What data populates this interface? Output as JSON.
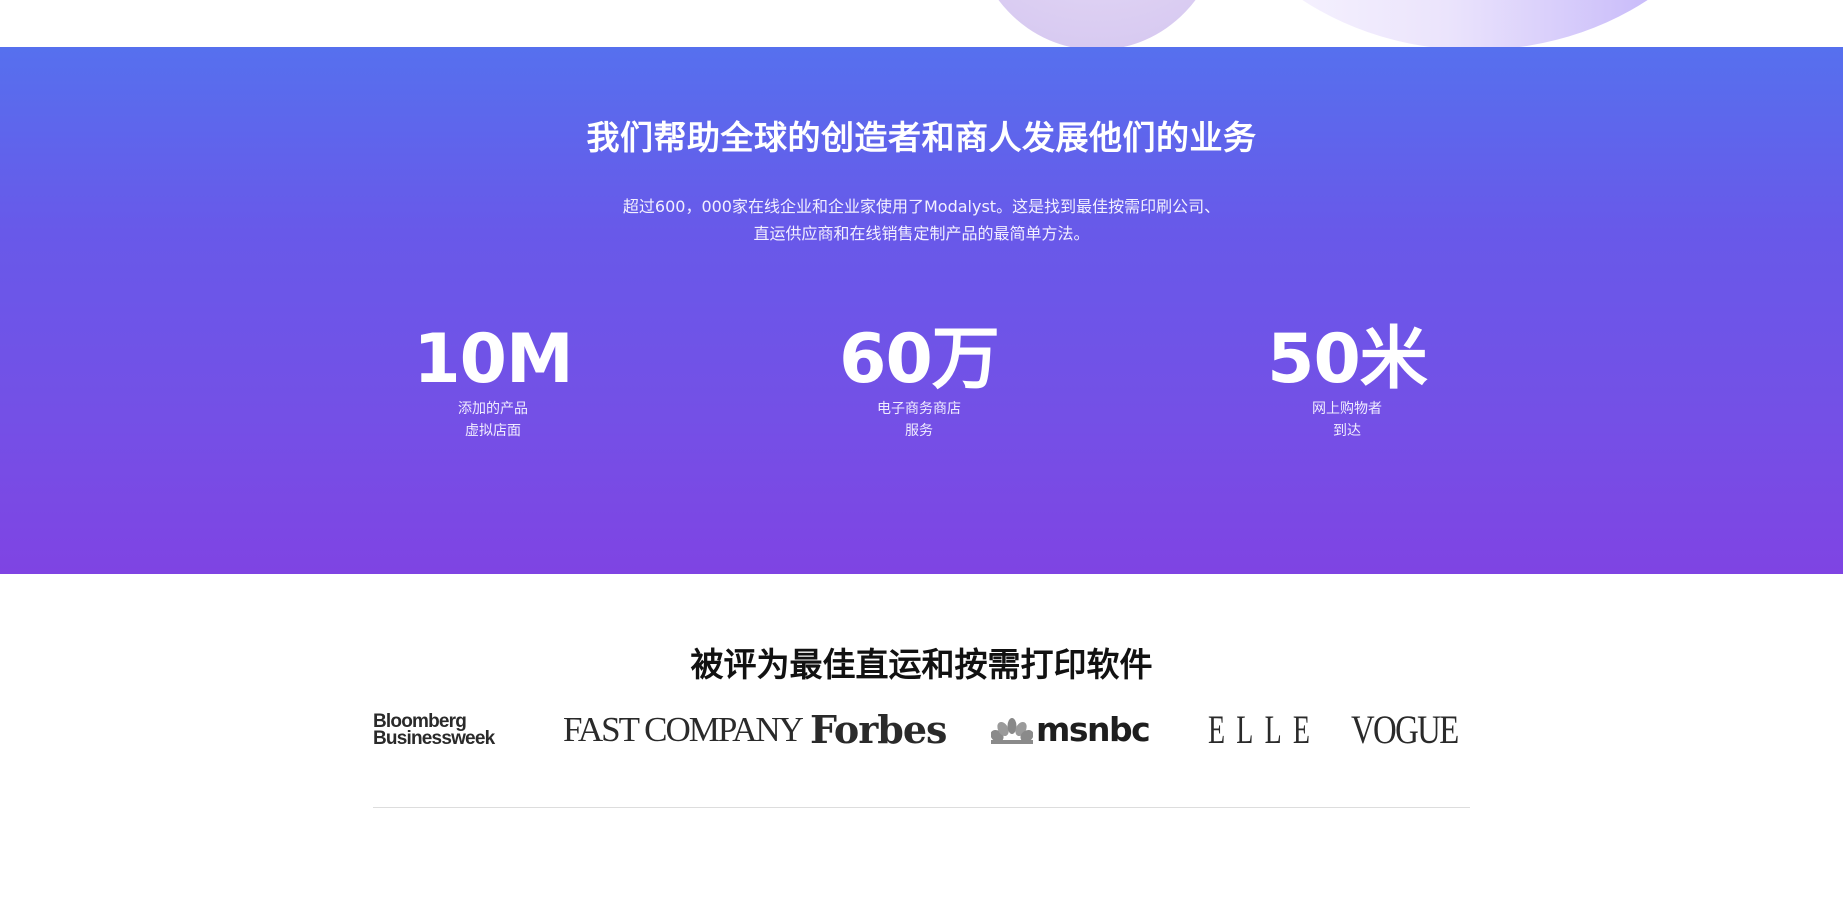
{
  "hero": {
    "title": "我们帮助全球的创造者和商人发展他们的业务",
    "subtitle_line1": "超过600，000家在线企业和企业家使用了Modalyst。这是找到最佳按需印刷公司、",
    "subtitle_line2": "直运供应商和在线销售定制产品的最简单方法。",
    "stats": [
      {
        "number": "10M",
        "label_line1": "添加的产品",
        "label_line2": "虚拟店面"
      },
      {
        "number": "60万",
        "label_line1": "电子商务商店",
        "label_line2": "服务"
      },
      {
        "number": "50米",
        "label_line1": "网上购物者",
        "label_line2": "到达"
      }
    ],
    "colors": {
      "gradient_top": "#5670ee",
      "gradient_bottom": "#7f44e3"
    }
  },
  "press": {
    "title": "被评为最佳直运和按需打印软件",
    "logos": [
      {
        "name": "bloomberg-businessweek",
        "line1": "Bloomberg",
        "line2": "Businessweek"
      },
      {
        "name": "fast-company",
        "text": "FAST COMPANY"
      },
      {
        "name": "forbes",
        "text": "Forbes"
      },
      {
        "name": "msnbc",
        "text": "msnbc",
        "icon": "peacock-icon"
      },
      {
        "name": "elle",
        "text": "ELLE"
      },
      {
        "name": "vogue",
        "text": "VOGUE"
      }
    ]
  }
}
